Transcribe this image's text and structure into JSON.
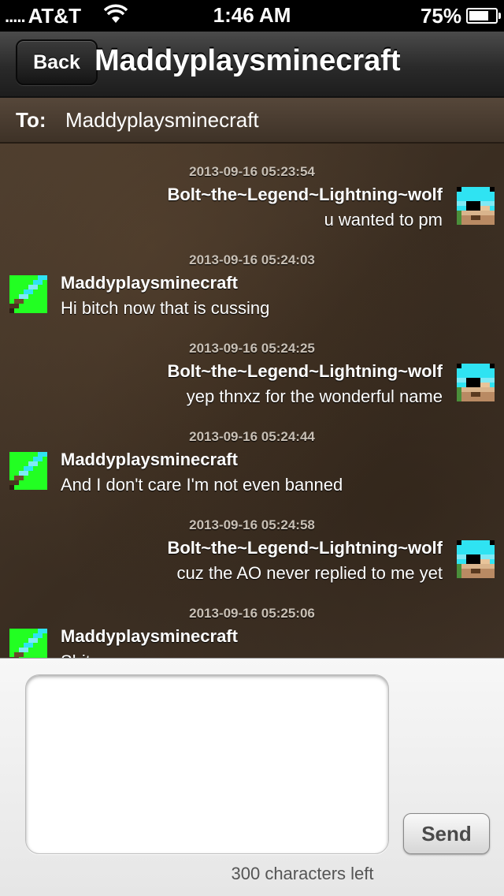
{
  "status_bar": {
    "signal": ".....",
    "carrier": "AT&T",
    "time": "1:46 AM",
    "battery_percent": "75%",
    "battery_level": 0.75,
    "wifi_icon": "wifi-icon",
    "battery_icon": "battery-icon"
  },
  "nav": {
    "back_label": "Back",
    "title": "Maddyplaysminecraft"
  },
  "to_bar": {
    "label": "To:",
    "value": "Maddyplaysminecraft"
  },
  "messages": [
    {
      "timestamp": "2013-09-16 05:23:54",
      "sender": "Bolt~the~Legend~Lightning~wolf",
      "text": "u wanted to pm",
      "side": "right"
    },
    {
      "timestamp": "2013-09-16 05:24:03",
      "sender": "Maddyplaysminecraft",
      "text": "Hi bitch now that is cussing",
      "side": "left"
    },
    {
      "timestamp": "2013-09-16 05:24:25",
      "sender": "Bolt~the~Legend~Lightning~wolf",
      "text": "yep thnxz for the wonderful name",
      "side": "right"
    },
    {
      "timestamp": "2013-09-16 05:24:44",
      "sender": "Maddyplaysminecraft",
      "text": "And I don't care I'm not even banned",
      "side": "left"
    },
    {
      "timestamp": "2013-09-16 05:24:58",
      "sender": "Bolt~the~Legend~Lightning~wolf",
      "text": "cuz the AO never replied to me yet",
      "side": "right"
    },
    {
      "timestamp": "2013-09-16 05:25:06",
      "sender": "Maddyplaysminecraft",
      "text": "Shit you son",
      "side": "left"
    }
  ],
  "compose": {
    "input_value": "",
    "send_label": "Send",
    "characters_left": "300 characters left"
  },
  "colors": {
    "nav_bar": "#2a2a2a",
    "message_background": "#3a2d21",
    "compose_background": "#eeeeee",
    "wolf_avatar_cyan": "#2fe3f2",
    "sword_avatar_green": "#22ff22"
  }
}
